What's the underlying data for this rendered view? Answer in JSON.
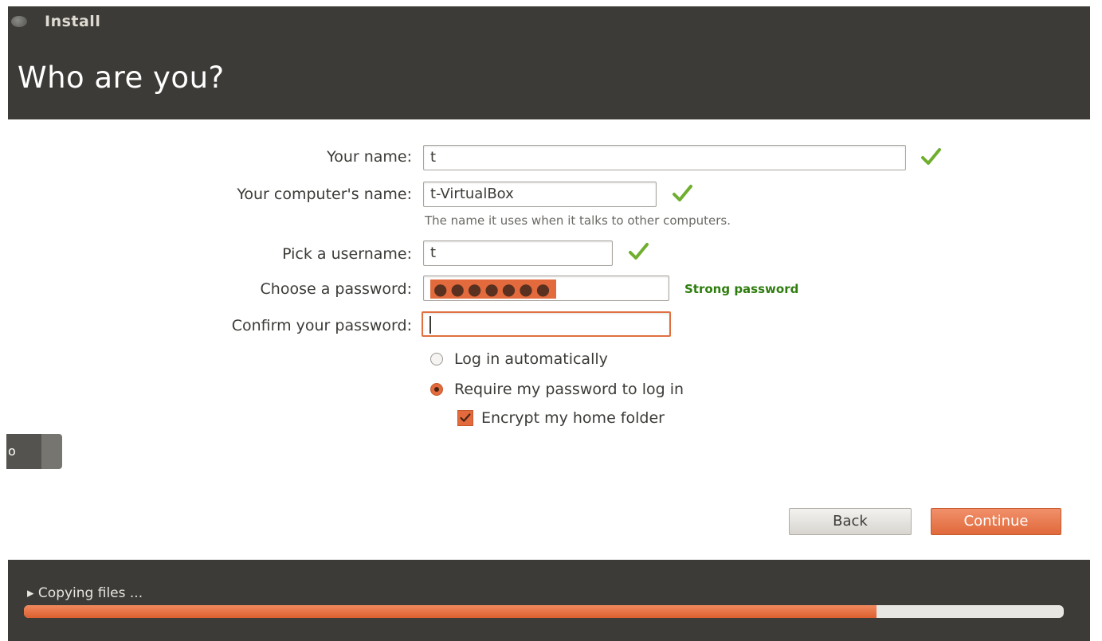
{
  "window": {
    "title": "Install"
  },
  "page": {
    "title": "Who are you?"
  },
  "form": {
    "name_label": "Your name:",
    "name_value": "t",
    "computer_label": "Your computer's name:",
    "computer_value": "t-VirtualBox",
    "computer_hint": "The name it uses when it talks to other computers.",
    "username_label": "Pick a username:",
    "username_value": "t",
    "password_label": "Choose a password:",
    "password_mask": "●●●●●●●",
    "password_strength": "Strong password",
    "confirm_label": "Confirm your password:",
    "confirm_value": ""
  },
  "options": {
    "login_auto": "Log in automatically",
    "require_password": "Require my password to log in",
    "encrypt_home": "Encrypt my home folder",
    "selected": "require_password",
    "encrypt_checked": true
  },
  "side_tab": {
    "label": "o"
  },
  "buttons": {
    "back": "Back",
    "continue": "Continue"
  },
  "progress": {
    "label": "▸ Copying files ...",
    "fraction": 0.82
  },
  "colors": {
    "accent": "#e36a3c",
    "dark_bar": "#3c3b37",
    "valid_check": "#6fae2e",
    "strength_text": "#2e7d0e"
  }
}
